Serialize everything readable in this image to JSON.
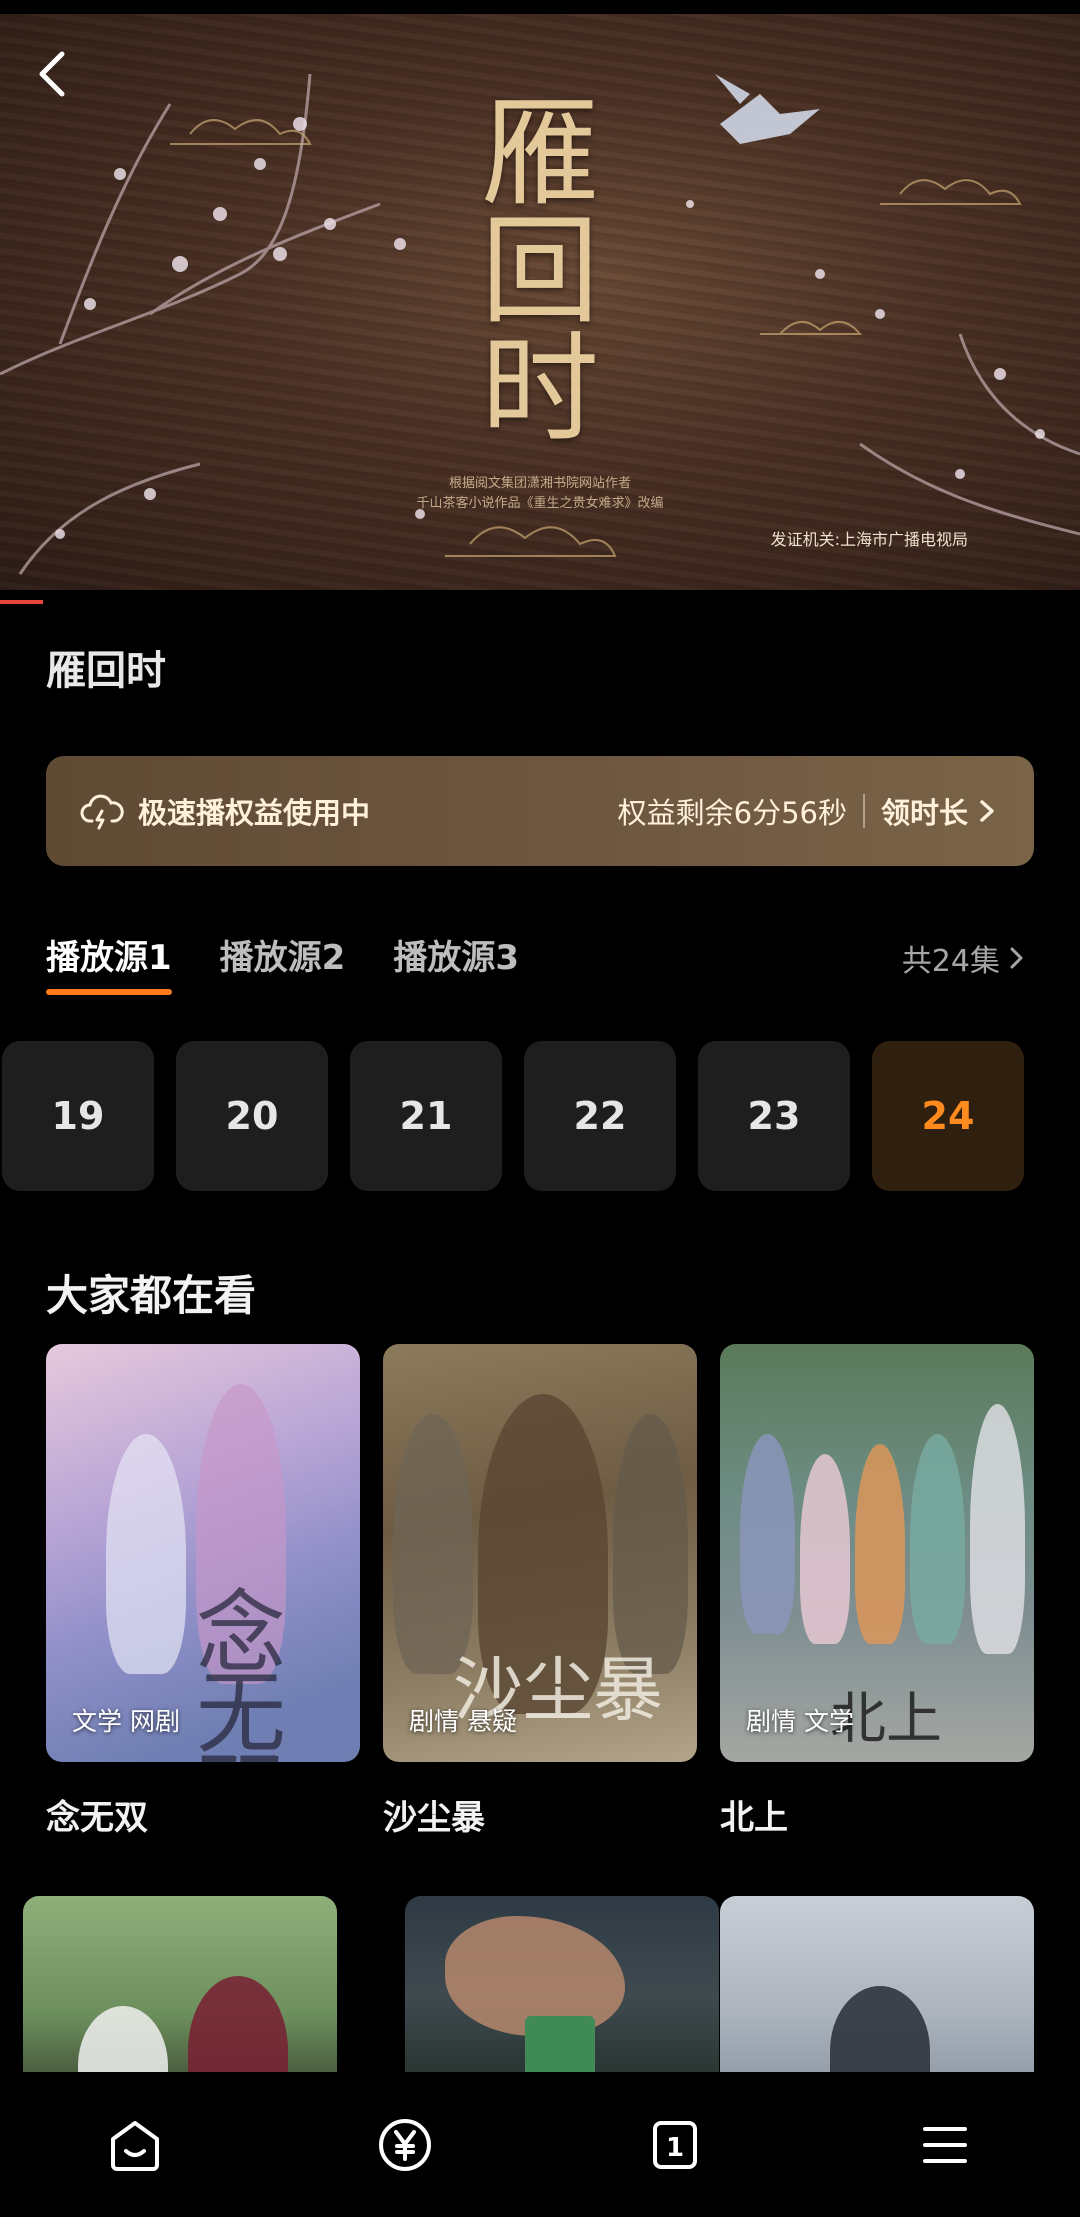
{
  "player": {
    "poster_title": [
      "雁",
      "回",
      "时"
    ],
    "poster_subtitle_lines": [
      "根据阅文集团潇湘书院网站作者",
      "千山茶客小说作品《重生之贵女难求》改编"
    ],
    "license_text": "发证机关:上海市广播电视局",
    "progress_fraction": 0.04
  },
  "show": {
    "title": "雁回时"
  },
  "promo": {
    "label": "极速播权益使用中",
    "remaining": "权益剩余6分56秒",
    "get_more": "领时长"
  },
  "sources": {
    "tabs": [
      {
        "label": "播放源1",
        "active": true
      },
      {
        "label": "播放源2",
        "active": false
      },
      {
        "label": "播放源3",
        "active": false
      }
    ],
    "episode_count": "共24集"
  },
  "episodes": [
    {
      "label": "19",
      "active": false
    },
    {
      "label": "20",
      "active": false
    },
    {
      "label": "21",
      "active": false
    },
    {
      "label": "22",
      "active": false
    },
    {
      "label": "23",
      "active": false
    },
    {
      "label": "24",
      "active": true
    }
  ],
  "recommend": {
    "title": "大家都在看",
    "items": [
      {
        "name": "念无双",
        "tags": "文学 网剧",
        "poster_text": "念无双"
      },
      {
        "name": "沙尘暴",
        "tags": "剧情 悬疑",
        "poster_text": "沙尘暴"
      },
      {
        "name": "北上",
        "tags": "剧情 文学",
        "poster_text": "北上"
      }
    ]
  },
  "colors": {
    "accent_orange": "#ff8a1e",
    "tab_underline": "#ff7a1a",
    "progress_red": "#e8453c",
    "promo_bg": "#6f5840"
  },
  "bottom_nav": {
    "icons": [
      "home-icon",
      "yen-coin-icon",
      "tab-count-icon",
      "menu-icon"
    ],
    "tab_count": "1"
  }
}
